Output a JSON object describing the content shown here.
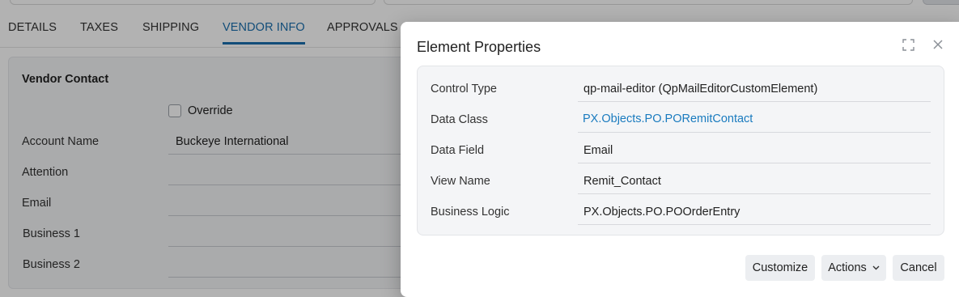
{
  "tabs": [
    {
      "label": "DETAILS"
    },
    {
      "label": "TAXES"
    },
    {
      "label": "SHIPPING"
    },
    {
      "label": "VENDOR INFO",
      "active": true
    },
    {
      "label": "APPROVALS"
    }
  ],
  "vendor_contact": {
    "title": "Vendor Contact",
    "override_label": "Override",
    "fields": [
      {
        "label": "Account Name",
        "value": "Buckeye International"
      },
      {
        "label": "Attention",
        "value": ""
      },
      {
        "label": "Email",
        "value": ""
      },
      {
        "label": "Business 1",
        "value": ""
      },
      {
        "label": "Business 2",
        "value": ""
      }
    ]
  },
  "modal": {
    "title": "Element Properties",
    "properties": [
      {
        "label": "Control Type",
        "value": "qp-mail-editor (QpMailEditorCustomElement)"
      },
      {
        "label": "Data Class",
        "value": "PX.Objects.PO.PORemitContact",
        "link": true
      },
      {
        "label": "Data Field",
        "value": "Email"
      },
      {
        "label": "View Name",
        "value": "Remit_Contact"
      },
      {
        "label": "Business Logic",
        "value": "PX.Objects.PO.POOrderEntry"
      }
    ],
    "buttons": {
      "customize": "Customize",
      "actions": "Actions",
      "cancel": "Cancel"
    }
  },
  "colors": {
    "accent": "#1a6fae",
    "link": "#1a7bbf"
  }
}
